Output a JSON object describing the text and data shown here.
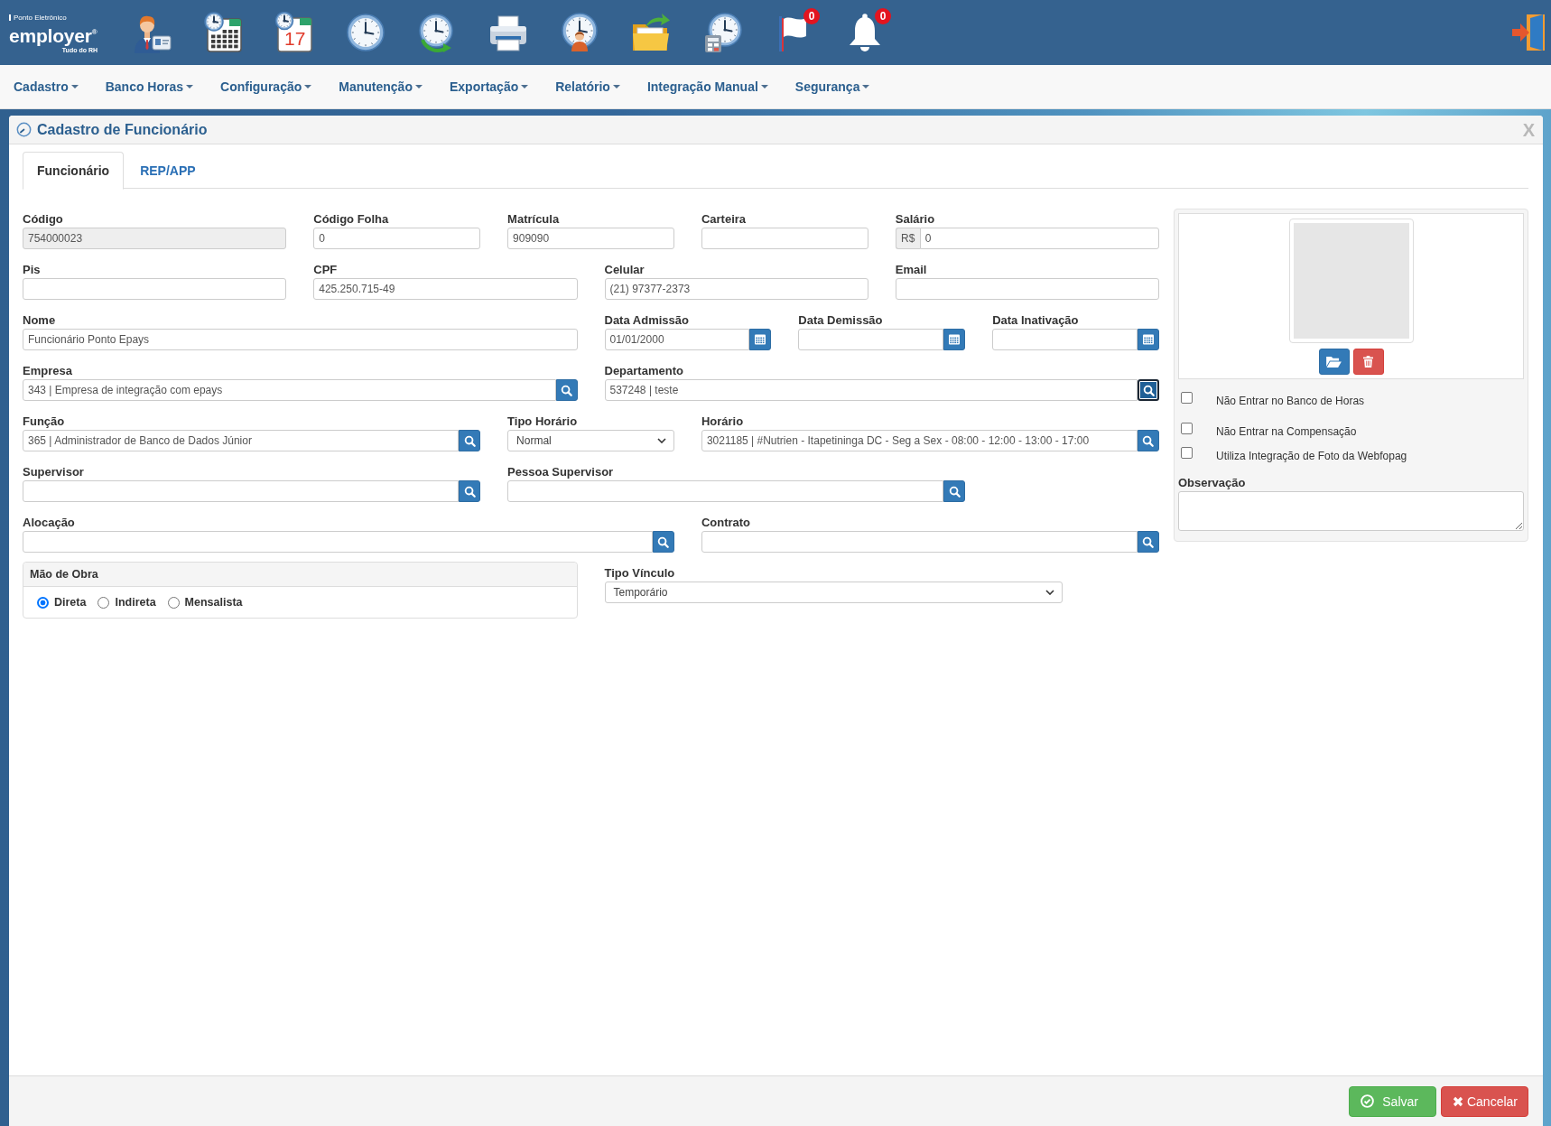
{
  "header": {
    "logo": {
      "tagline": "Ponto Eletrônico",
      "wordmark": "employer$^{®}$",
      "subtitle": "Tudo do RH"
    },
    "toolbar": [
      {
        "kind": "employee"
      },
      {
        "kind": "schedule"
      },
      {
        "kind": "calendar",
        "text": "17"
      },
      {
        "kind": "clock"
      },
      {
        "kind": "sync"
      },
      {
        "kind": "printer"
      },
      {
        "kind": "person"
      },
      {
        "kind": "folder"
      },
      {
        "kind": "calculator"
      },
      {
        "kind": "flag",
        "badge": "0"
      },
      {
        "kind": "bell",
        "badge": "0"
      }
    ]
  },
  "menu": [
    {
      "label": "Cadastro"
    },
    {
      "label": "Banco Horas"
    },
    {
      "label": "Configuração"
    },
    {
      "label": "Manutenção"
    },
    {
      "label": "Exportação"
    },
    {
      "label": "Relatório"
    },
    {
      "label": "Integração Manual"
    },
    {
      "label": "Segurança"
    }
  ],
  "window": {
    "title": "Cadastro de Funcionário",
    "close": "X"
  },
  "tabs": [
    {
      "label": "Funcionário",
      "selected": true
    },
    {
      "label": "REP/APP",
      "selected": false
    }
  ],
  "form": {
    "fields": [
      {
        "kind": "text",
        "label": "Código",
        "value": "754000023",
        "disabled": true,
        "focused": false
      },
      {
        "kind": "text",
        "label": "Código Folha",
        "value": "0",
        "disabled": false,
        "focused": false
      },
      {
        "kind": "text",
        "label": "Matrícula",
        "value": "909090",
        "disabled": false,
        "focused": false
      },
      {
        "kind": "text",
        "label": "Carteira",
        "disabled": false,
        "focused": false
      },
      {
        "kind": "money",
        "label": "Salário",
        "prefix": "R$",
        "value": "0",
        "disabled": false,
        "focused": false
      },
      {
        "kind": "text",
        "label": "Pis",
        "disabled": false,
        "focused": false
      },
      {
        "kind": "text",
        "label": "CPF",
        "value": "425.250.715-49",
        "disabled": false,
        "focused": false
      },
      {
        "kind": "text",
        "label": "Celular",
        "value": "(21) 97377-2373",
        "disabled": false,
        "focused": false
      },
      {
        "kind": "text",
        "label": "Email",
        "disabled": false,
        "focused": false
      },
      {
        "kind": "text",
        "label": "Nome",
        "value": "Funcionário Ponto Epays",
        "disabled": false,
        "focused": false
      },
      {
        "kind": "date",
        "label": "Data Admissão",
        "value": "01/01/2000",
        "disabled": false,
        "focused": false
      },
      {
        "kind": "date",
        "label": "Data Demissão",
        "disabled": false,
        "focused": false
      },
      {
        "kind": "date",
        "label": "Data Inativação",
        "disabled": false,
        "focused": false
      },
      {
        "kind": "lookup",
        "label": "Empresa",
        "value": "343 | Empresa de integração com epays",
        "disabled": false,
        "focused": false
      },
      {
        "kind": "lookup",
        "label": "Departamento",
        "value": "537248 | teste",
        "disabled": false,
        "focused": true
      },
      {
        "kind": "lookup",
        "label": "Função",
        "value": "365 | Administrador de Banco de Dados Júnior",
        "disabled": false,
        "focused": false
      },
      {
        "kind": "select",
        "label": "Tipo Horário",
        "value": "Normal",
        "disabled": false,
        "focused": false
      },
      {
        "kind": "lookup",
        "label": "Horário",
        "value": "3021185 | #Nutrien - Itapetininga DC - Seg a Sex - 08:00 - 12:00 - 13:00 - 17:00",
        "disabled": false,
        "focused": false
      },
      {
        "kind": "lookup",
        "label": "Supervisor",
        "disabled": false,
        "focused": false
      },
      {
        "kind": "lookup",
        "label": "Pessoa Supervisor",
        "disabled": false,
        "focused": false
      },
      {
        "kind": "lookup",
        "label": "Alocação",
        "disabled": false,
        "focused": false
      },
      {
        "kind": "lookup",
        "label": "Contrato",
        "disabled": false,
        "focused": false
      },
      {
        "kind": "radios",
        "label": "Mão de Obra",
        "disabled": false,
        "focused": false,
        "options": [
          {
            "label": "Direta",
            "selected": true
          },
          {
            "label": "Indireta",
            "selected": false
          },
          {
            "label": "Mensalista",
            "selected": false
          }
        ]
      },
      {
        "kind": "select",
        "label": "Tipo Vínculo",
        "value": "Temporário",
        "disabled": false,
        "focused": false
      }
    ]
  },
  "photo_panel": {
    "checkboxes": [
      {
        "label": "Não Entrar no Banco de Horas",
        "checked": false
      },
      {
        "label": "Não Entrar na Compensação",
        "checked": false
      },
      {
        "label": "Utiliza Integração de Foto da Webfopag",
        "checked": false
      }
    ],
    "observation": {
      "label": "Observação"
    }
  },
  "footer": {
    "buttons": [
      {
        "kind": "save",
        "label": "Salvar"
      },
      {
        "kind": "cancel",
        "label": "Cancelar"
      }
    ]
  }
}
